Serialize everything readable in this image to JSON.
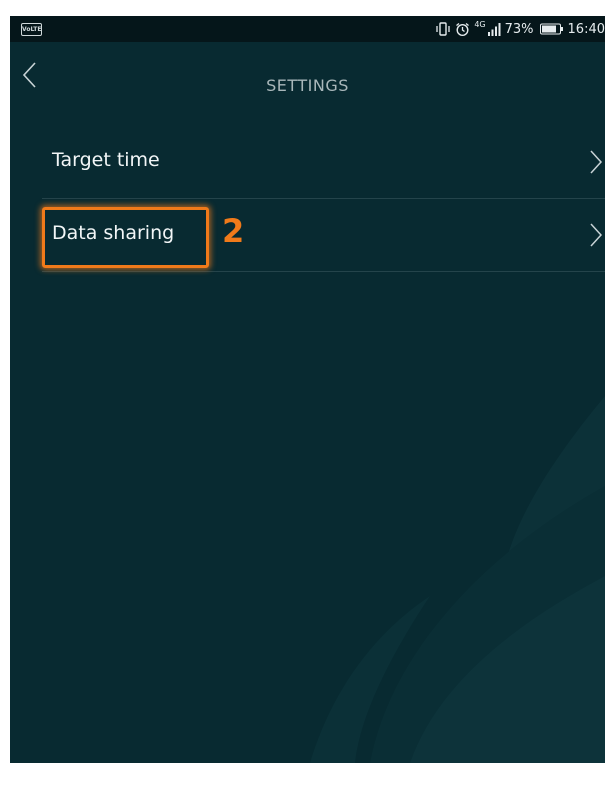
{
  "status_bar": {
    "volte": "VoLTE",
    "network": "4G",
    "battery": "73%",
    "time": "16:40"
  },
  "header": {
    "title": "SETTINGS"
  },
  "menu": {
    "items": [
      {
        "label": "Target time"
      },
      {
        "label": "Data sharing"
      }
    ]
  },
  "annotation": {
    "step_number": "2",
    "color": "#f07a1a"
  },
  "colors": {
    "background": "#082a31",
    "text": "#f2f6f7",
    "title": "#a9b7ba"
  }
}
